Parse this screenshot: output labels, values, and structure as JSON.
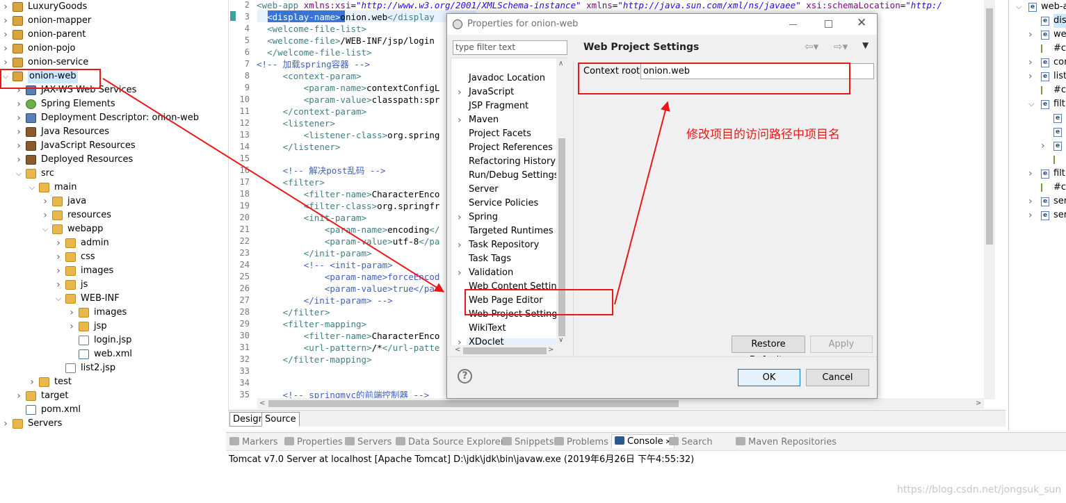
{
  "tree": {
    "items": [
      {
        "label": "LuxuryGoods",
        "indent": 0,
        "icon": "project-icon",
        "tw": ">"
      },
      {
        "label": "onion-mapper",
        "indent": 0,
        "icon": "project-icon",
        "tw": ">"
      },
      {
        "label": "onion-parent",
        "indent": 0,
        "icon": "project-icon",
        "tw": ">"
      },
      {
        "label": "onion-pojo",
        "indent": 0,
        "icon": "project-icon",
        "tw": ">"
      },
      {
        "label": "onion-service",
        "indent": 0,
        "icon": "project-icon",
        "tw": ">"
      },
      {
        "label": "onion-web",
        "indent": 0,
        "icon": "project-icon",
        "tw": "v"
      },
      {
        "label": "JAX-WS Web Services",
        "indent": 1,
        "icon": "webservice-icon",
        "tw": ">"
      },
      {
        "label": "Spring Elements",
        "indent": 1,
        "icon": "spring-icon",
        "tw": ">"
      },
      {
        "label": "Deployment Descriptor: onion-web",
        "indent": 1,
        "icon": "descriptor-icon",
        "tw": ">"
      },
      {
        "label": "Java Resources",
        "indent": 1,
        "icon": "java-resources-icon",
        "tw": ">"
      },
      {
        "label": "JavaScript Resources",
        "indent": 1,
        "icon": "js-resources-icon",
        "tw": ">"
      },
      {
        "label": "Deployed Resources",
        "indent": 1,
        "icon": "deployed-icon",
        "tw": ">"
      },
      {
        "label": "src",
        "indent": 1,
        "icon": "folder-icon",
        "tw": "v"
      },
      {
        "label": "main",
        "indent": 2,
        "icon": "folder-icon",
        "tw": "v"
      },
      {
        "label": "java",
        "indent": 3,
        "icon": "folder-icon",
        "tw": ">"
      },
      {
        "label": "resources",
        "indent": 3,
        "icon": "folder-icon",
        "tw": ">"
      },
      {
        "label": "webapp",
        "indent": 3,
        "icon": "folder-icon",
        "tw": "v"
      },
      {
        "label": "admin",
        "indent": 4,
        "icon": "folder-icon",
        "tw": ">"
      },
      {
        "label": "css",
        "indent": 4,
        "icon": "folder-icon",
        "tw": ">"
      },
      {
        "label": "images",
        "indent": 4,
        "icon": "folder-icon",
        "tw": ">"
      },
      {
        "label": "js",
        "indent": 4,
        "icon": "folder-icon",
        "tw": ">"
      },
      {
        "label": "WEB-INF",
        "indent": 4,
        "icon": "folder-icon",
        "tw": "v"
      },
      {
        "label": "images",
        "indent": 5,
        "icon": "folder-icon",
        "tw": ">"
      },
      {
        "label": "jsp",
        "indent": 5,
        "icon": "folder-icon",
        "tw": ">"
      },
      {
        "label": "login.jsp",
        "indent": 5,
        "icon": "file-icon",
        "tw": ""
      },
      {
        "label": "web.xml",
        "indent": 5,
        "icon": "xml-file-icon",
        "tw": ""
      },
      {
        "label": "list2.jsp",
        "indent": 4,
        "icon": "file-icon",
        "tw": ""
      },
      {
        "label": "test",
        "indent": 2,
        "icon": "folder-icon",
        "tw": ">"
      },
      {
        "label": "target",
        "indent": 1,
        "icon": "folder-icon",
        "tw": ">"
      },
      {
        "label": "pom.xml",
        "indent": 1,
        "icon": "maven-file-icon",
        "tw": ""
      },
      {
        "label": "Servers",
        "indent": 0,
        "icon": "folder-icon",
        "tw": ">"
      }
    ]
  },
  "editor": {
    "lines": [
      {
        "n": "2",
        "m": "⊖",
        "html": [
          [
            "tag",
            "<"
          ],
          [
            "tag",
            "web-app "
          ],
          [
            "at",
            "xmlns:xsi"
          ],
          [
            "tx",
            "="
          ],
          [
            "av",
            "\"http://www.w3.org/2001/XMLSchema-instance\""
          ],
          [
            "tx",
            " "
          ],
          [
            "at",
            "xmlns"
          ],
          [
            "tx",
            "="
          ],
          [
            "av",
            "\"http://java.sun.com/xml/ns/javaee\""
          ],
          [
            "tx",
            " "
          ],
          [
            "at",
            "xsi:schemaLocation"
          ],
          [
            "tx",
            "="
          ],
          [
            "av",
            "\"http:/"
          ]
        ]
      },
      {
        "n": "3",
        "m": "",
        "html": [
          [
            "tx",
            "  "
          ],
          [
            "tag",
            "<display-name>"
          ],
          [
            "tx",
            "onion.web"
          ],
          [
            "tag",
            "</display"
          ]
        ]
      },
      {
        "n": "4",
        "m": "⊖",
        "html": [
          [
            "tx",
            "  "
          ],
          [
            "tag",
            "<welcome-file-list>"
          ]
        ]
      },
      {
        "n": "5",
        "m": "",
        "html": [
          [
            "tx",
            "  "
          ],
          [
            "tag",
            "<welcome-file>"
          ],
          [
            "tx",
            "/WEB-INF/jsp/login"
          ]
        ]
      },
      {
        "n": "6",
        "m": "",
        "html": [
          [
            "tx",
            "  "
          ],
          [
            "tag",
            "</welcome-file-list>"
          ]
        ]
      },
      {
        "n": "7",
        "m": "",
        "html": [
          [
            "cm",
            "<!-- 加载spring容器 -->"
          ]
        ]
      },
      {
        "n": "8",
        "m": "⊖",
        "html": [
          [
            "tx",
            "     "
          ],
          [
            "tag",
            "<context-param>"
          ]
        ]
      },
      {
        "n": "9",
        "m": "",
        "html": [
          [
            "tx",
            "         "
          ],
          [
            "tag",
            "<param-name>"
          ],
          [
            "tx",
            "contextConfigL"
          ]
        ]
      },
      {
        "n": "10",
        "m": "",
        "html": [
          [
            "tx",
            "         "
          ],
          [
            "tag",
            "<param-value>"
          ],
          [
            "tx",
            "classpath:spr"
          ]
        ]
      },
      {
        "n": "11",
        "m": "",
        "html": [
          [
            "tx",
            "     "
          ],
          [
            "tag",
            "</context-param>"
          ]
        ]
      },
      {
        "n": "12",
        "m": "⊖",
        "html": [
          [
            "tx",
            "     "
          ],
          [
            "tag",
            "<listener>"
          ]
        ]
      },
      {
        "n": "13",
        "m": "",
        "html": [
          [
            "tx",
            "         "
          ],
          [
            "tag",
            "<listener-class>"
          ],
          [
            "tx",
            "org.spring"
          ]
        ]
      },
      {
        "n": "14",
        "m": "",
        "html": [
          [
            "tx",
            "     "
          ],
          [
            "tag",
            "</listener>"
          ]
        ]
      },
      {
        "n": "15",
        "m": "",
        "html": []
      },
      {
        "n": "16",
        "m": "",
        "html": [
          [
            "tx",
            "     "
          ],
          [
            "cm",
            "<!-- 解决post乱码 -->"
          ]
        ]
      },
      {
        "n": "17",
        "m": "⊖",
        "html": [
          [
            "tx",
            "     "
          ],
          [
            "tag",
            "<filter>"
          ]
        ]
      },
      {
        "n": "18",
        "m": "",
        "html": [
          [
            "tx",
            "         "
          ],
          [
            "tag",
            "<filter-name>"
          ],
          [
            "tx",
            "CharacterEnco"
          ]
        ]
      },
      {
        "n": "19",
        "m": "",
        "html": [
          [
            "tx",
            "         "
          ],
          [
            "tag",
            "<filter-class>"
          ],
          [
            "tx",
            "org.springfr"
          ]
        ]
      },
      {
        "n": "20",
        "m": "⊖",
        "html": [
          [
            "tx",
            "         "
          ],
          [
            "tag",
            "<init-param>"
          ]
        ]
      },
      {
        "n": "21",
        "m": "",
        "html": [
          [
            "tx",
            "             "
          ],
          [
            "tag",
            "<param-name>"
          ],
          [
            "tx",
            "encoding"
          ],
          [
            "tag",
            "</"
          ]
        ]
      },
      {
        "n": "22",
        "m": "",
        "html": [
          [
            "tx",
            "             "
          ],
          [
            "tag",
            "<param-value>"
          ],
          [
            "tx",
            "utf-8"
          ],
          [
            "tag",
            "</pa"
          ]
        ]
      },
      {
        "n": "23",
        "m": "",
        "html": [
          [
            "tx",
            "         "
          ],
          [
            "tag",
            "</init-param>"
          ]
        ]
      },
      {
        "n": "24",
        "m": "⊖",
        "html": [
          [
            "tx",
            "         "
          ],
          [
            "cm",
            "<!-- <init-param>"
          ]
        ]
      },
      {
        "n": "25",
        "m": "",
        "html": [
          [
            "tx",
            "             "
          ],
          [
            "cm",
            "<param-name>forceEncod"
          ]
        ]
      },
      {
        "n": "26",
        "m": "",
        "html": [
          [
            "tx",
            "             "
          ],
          [
            "cm",
            "<param-value>true</pa"
          ]
        ]
      },
      {
        "n": "27",
        "m": "",
        "html": [
          [
            "tx",
            "         "
          ],
          [
            "cm",
            "</init-param> -->"
          ]
        ]
      },
      {
        "n": "28",
        "m": "",
        "html": [
          [
            "tx",
            "     "
          ],
          [
            "tag",
            "</filter>"
          ]
        ]
      },
      {
        "n": "29",
        "m": "⊖",
        "html": [
          [
            "tx",
            "     "
          ],
          [
            "tag",
            "<filter-mapping>"
          ]
        ]
      },
      {
        "n": "30",
        "m": "",
        "html": [
          [
            "tx",
            "         "
          ],
          [
            "tag",
            "<filter-name>"
          ],
          [
            "tx",
            "CharacterEnco"
          ]
        ]
      },
      {
        "n": "31",
        "m": "",
        "html": [
          [
            "tx",
            "         "
          ],
          [
            "tag",
            "<url-pattern>"
          ],
          [
            "tx",
            "/*"
          ],
          [
            "tag",
            "</url-patte"
          ]
        ]
      },
      {
        "n": "32",
        "m": "",
        "html": [
          [
            "tx",
            "     "
          ],
          [
            "tag",
            "</filter-mapping>"
          ]
        ]
      },
      {
        "n": "33",
        "m": "",
        "html": []
      },
      {
        "n": "34",
        "m": "",
        "html": []
      },
      {
        "n": "35",
        "m": "",
        "html": [
          [
            "tx",
            "     "
          ],
          [
            "cm",
            "<!-- springmvc的前端控制器 -->"
          ]
        ]
      }
    ],
    "tabs": [
      "Design",
      "Source"
    ]
  },
  "outline": {
    "items": [
      {
        "label": "web-a",
        "indent": 0,
        "tw": "v"
      },
      {
        "label": "dis",
        "indent": 1,
        "tw": "",
        "sel": true
      },
      {
        "label": "we",
        "indent": 1,
        "tw": ">"
      },
      {
        "label": "#c",
        "indent": 1,
        "tw": "",
        "comment": true
      },
      {
        "label": "cor",
        "indent": 1,
        "tw": ">"
      },
      {
        "label": "list",
        "indent": 1,
        "tw": ">"
      },
      {
        "label": "#c",
        "indent": 1,
        "tw": "",
        "comment": true
      },
      {
        "label": "filt",
        "indent": 1,
        "tw": "v"
      },
      {
        "label": "",
        "indent": 2,
        "tw": ""
      },
      {
        "label": "",
        "indent": 2,
        "tw": ""
      },
      {
        "label": "",
        "indent": 2,
        "tw": ">"
      },
      {
        "label": "",
        "indent": 2,
        "tw": "",
        "comment": true
      },
      {
        "label": "filt",
        "indent": 1,
        "tw": ">"
      },
      {
        "label": "#c",
        "indent": 1,
        "tw": "",
        "comment": true
      },
      {
        "label": "ser",
        "indent": 1,
        "tw": ">"
      },
      {
        "label": "ser",
        "indent": 1,
        "tw": ">"
      }
    ]
  },
  "views": {
    "tabs": [
      "Markers",
      "Properties",
      "Servers",
      "Data Source Explorer",
      "Snippets",
      "Problems",
      "Console",
      "Search",
      "Maven Repositories"
    ],
    "active": "Console",
    "console_text": "Tomcat v7.0 Server at localhost [Apache Tomcat] D:\\jdk\\jdk\\bin\\javaw.exe (2019年6月26日 下午4:55:32)"
  },
  "dialog": {
    "title": "Properties for onion-web",
    "filter_placeholder": "type filter text",
    "items": [
      {
        "label": "Javadoc Location",
        "chev": ""
      },
      {
        "label": "JavaScript",
        "chev": ">"
      },
      {
        "label": "JSP Fragment",
        "chev": ""
      },
      {
        "label": "Maven",
        "chev": ">"
      },
      {
        "label": "Project Facets",
        "chev": ""
      },
      {
        "label": "Project References",
        "chev": ""
      },
      {
        "label": "Refactoring History",
        "chev": ""
      },
      {
        "label": "Run/Debug Settings",
        "chev": ""
      },
      {
        "label": "Server",
        "chev": ""
      },
      {
        "label": "Service Policies",
        "chev": ""
      },
      {
        "label": "Spring",
        "chev": ">"
      },
      {
        "label": "Targeted Runtimes",
        "chev": ""
      },
      {
        "label": "Task Repository",
        "chev": ">"
      },
      {
        "label": "Task Tags",
        "chev": ""
      },
      {
        "label": "Validation",
        "chev": ">"
      },
      {
        "label": "Web Content Settings",
        "chev": ""
      },
      {
        "label": "Web Page Editor",
        "chev": ""
      },
      {
        "label": "Web Project Settings",
        "chev": ""
      },
      {
        "label": "WikiText",
        "chev": ""
      },
      {
        "label": "XDoclet",
        "chev": ">"
      }
    ],
    "page_title": "Web Project Settings",
    "context_root_label": "Context root:",
    "context_root_value": "onion.web",
    "restore_defaults": "Restore Defaults",
    "apply": "Apply",
    "ok": "OK",
    "cancel": "Cancel"
  },
  "annotation": "修改项目的访问路径中项目名",
  "watermark": "https://blog.csdn.net/jongsuk_sun",
  "colors": {
    "annotation_red": "#e81818",
    "selection": "#cce8ff",
    "ok_border": "#0078d7"
  }
}
